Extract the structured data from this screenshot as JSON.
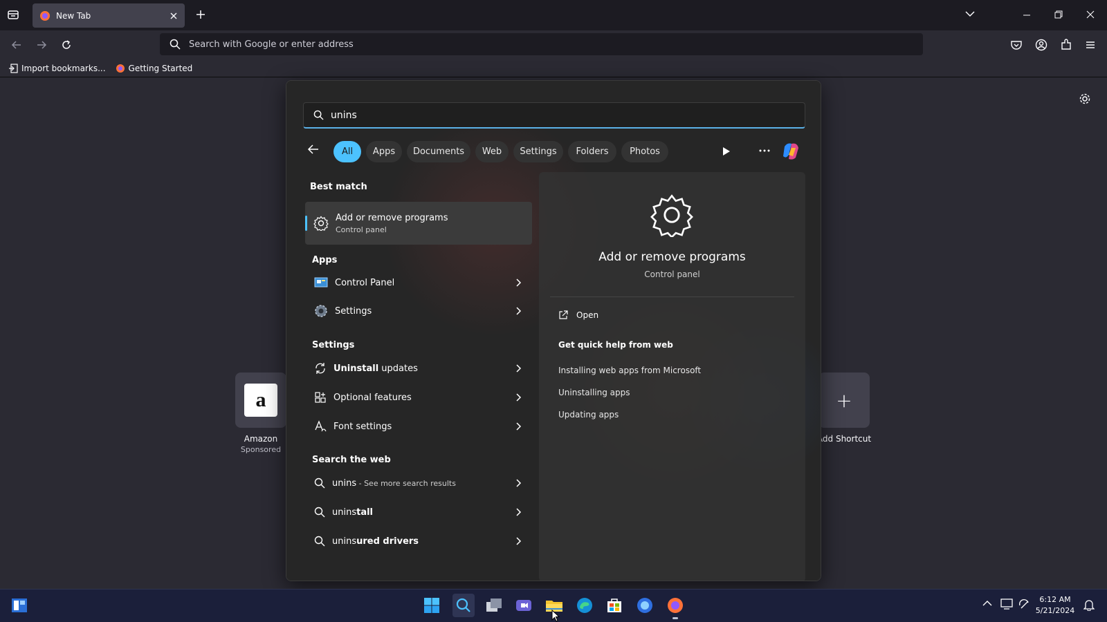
{
  "browser": {
    "tab_title": "New Tab",
    "url_placeholder": "Search with Google or enter address",
    "bookmarks": [
      "Import bookmarks...",
      "Getting Started"
    ]
  },
  "newtab": {
    "shortcuts": [
      {
        "label": "Amazon",
        "sub": "Sponsored",
        "glyph": "a"
      },
      {
        "label": "Add Shortcut",
        "sub": "",
        "glyph": "+"
      }
    ]
  },
  "search": {
    "query": "unins",
    "filters": [
      "All",
      "Apps",
      "Documents",
      "Web",
      "Settings",
      "Folders",
      "Photos"
    ],
    "best_match_heading": "Best match",
    "best_match": {
      "title": "Add or remove programs",
      "subtitle": "Control panel"
    },
    "apps_heading": "Apps",
    "apps": [
      "Control Panel",
      "Settings"
    ],
    "settings_heading": "Settings",
    "settings_items": [
      {
        "bold": "Uninstall",
        "rest": " updates"
      },
      {
        "bold": "",
        "rest": "Optional features"
      },
      {
        "bold": "",
        "rest": "Font settings"
      }
    ],
    "web_heading": "Search the web",
    "web_items": [
      {
        "bold": "unins",
        "rest": "",
        "sub": " - See more search results"
      },
      {
        "bold": "unins",
        "rest": "tall",
        "sub": ""
      },
      {
        "bold": "unins",
        "rest": "ured drivers",
        "sub": ""
      }
    ],
    "detail": {
      "title": "Add or remove programs",
      "subtitle": "Control panel",
      "open_label": "Open",
      "help_heading": "Get quick help from web",
      "help_links": [
        "Installing web apps from Microsoft",
        "Uninstalling apps",
        "Updating apps"
      ]
    }
  },
  "taskbar": {
    "time": "6:12 AM",
    "date": "5/21/2024"
  }
}
